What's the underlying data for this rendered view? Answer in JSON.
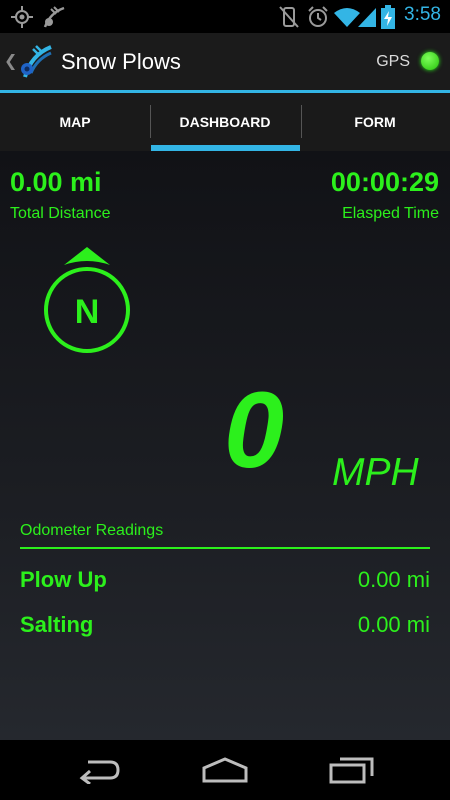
{
  "status_bar": {
    "time": "3:58",
    "left_icons": [
      "gps-satellite-icon",
      "notification-app-icon"
    ],
    "right_icons": [
      "vibrate-icon",
      "alarm-icon",
      "wifi-icon",
      "cell-signal-icon",
      "battery-charging-icon"
    ]
  },
  "action_bar": {
    "title": "Snow Plows",
    "gps_label": "GPS",
    "gps_status_color": "#2cf01c"
  },
  "tabs": [
    {
      "label": "MAP",
      "active": false
    },
    {
      "label": "DASHBOARD",
      "active": true
    },
    {
      "label": "FORM",
      "active": false
    }
  ],
  "dashboard": {
    "distance_value": "0.00 mi",
    "distance_label": "Total Distance",
    "time_value": "00:00:29",
    "time_label": "Elasped Time",
    "heading": "N",
    "speed_value": "0",
    "speed_unit": "MPH",
    "odometer_title": "Odometer Readings",
    "odometer": [
      {
        "label": "Plow Up",
        "value": "0.00 mi"
      },
      {
        "label": "Salting",
        "value": "0.00 mi"
      }
    ]
  },
  "colors": {
    "accent": "#33b5e5",
    "dashboard_green": "#2cf01c"
  },
  "nav_bar": {
    "buttons": [
      "back-icon",
      "home-icon",
      "recent-apps-icon"
    ]
  }
}
